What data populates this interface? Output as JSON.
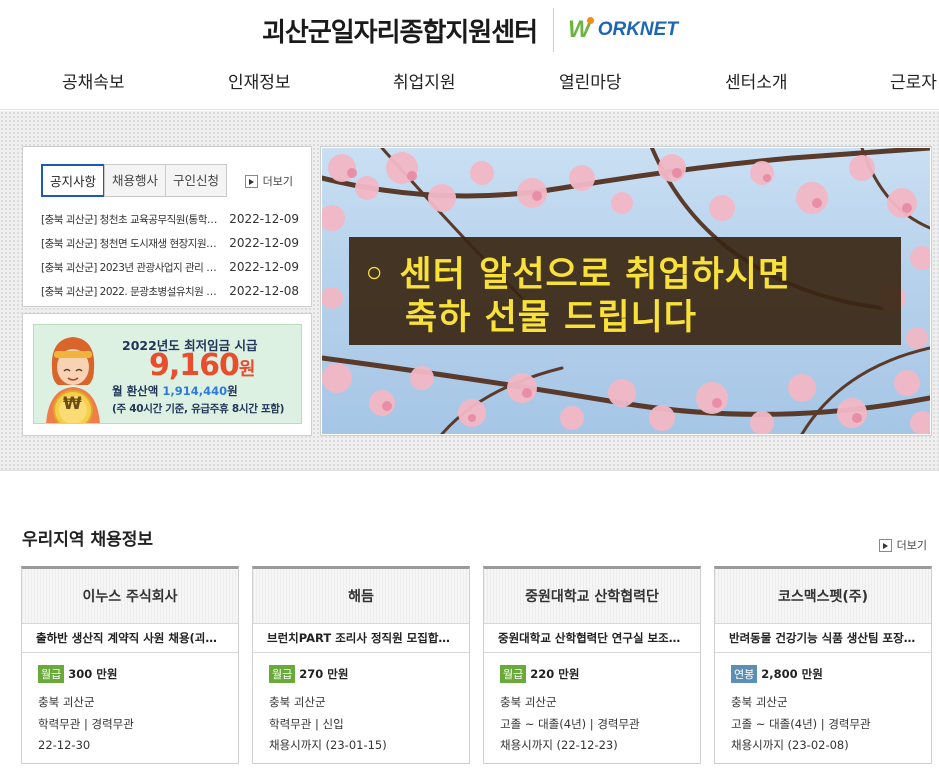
{
  "header": {
    "site_title": "괴산군일자리종합지원센터",
    "worknet_logo": {
      "first": "W",
      "rest": "ORKNET"
    },
    "nav": [
      "공채속보",
      "인재정보",
      "취업지원",
      "열린마당",
      "센터소개",
      "근로자"
    ]
  },
  "notice": {
    "tabs": [
      "공지사항",
      "채용행사",
      "구인신청"
    ],
    "active_tab": "공지사항",
    "more_label": "더보기",
    "items": [
      {
        "title": "[충북 괴산군] 청천초 교육공무직원(통학…",
        "date": "2022-12-09"
      },
      {
        "title": "[충북 괴산군] 청천면 도시재생 현장지원…",
        "date": "2022-12-09"
      },
      {
        "title": "[충북 괴산군] 2023년 관광사업지 관리 사…",
        "date": "2022-12-09"
      },
      {
        "title": "[충북 괴산군] 2022. 문광초병설유치원 거…",
        "date": "2022-12-08"
      }
    ]
  },
  "wage_banner": {
    "line1": "2022년도 최저임금 시급",
    "amount": "9,160",
    "unit": "원",
    "line3_prefix": "월 환산액 ",
    "line3_amount": "1,914,440",
    "line3_suffix": "원",
    "line4": "(주 40시간 기준, 유급주휴 8시간 포함)",
    "coin_symbol": "₩"
  },
  "main_banner": {
    "line1": "◦ 센터 알선으로 취업하시면",
    "line2": "축하 선물 드립니다"
  },
  "jobs": {
    "title": "우리지역 채용정보",
    "more_label": "더보기",
    "colors": {
      "monthly_badge": "#6aaa3a",
      "annual_badge": "#5b8fb5"
    },
    "cards": [
      {
        "company": "이누스 주식회사",
        "post": "출하반 생산직 계약직 사원 채용(괴산…",
        "pay_type": "월급",
        "pay": "300 만원",
        "location": "충북 괴산군",
        "requirements": "학력무관 | 경력무관",
        "deadline": "22-12-30"
      },
      {
        "company": "해듬",
        "post": "브런치PART 조리사 정직원 모집합…",
        "pay_type": "월급",
        "pay": "270 만원",
        "location": "충북 괴산군",
        "requirements": "학력무관 | 신입",
        "deadline": "채용시까지 (23-01-15)"
      },
      {
        "company": "중원대학교 산학협력단",
        "post": "중원대학교 산학협력단 연구실 보조…",
        "pay_type": "월급",
        "pay": "220 만원",
        "location": "충북 괴산군",
        "requirements": "고졸 ~ 대졸(4년) | 경력무관",
        "deadline": "채용시까지 (22-12-23)"
      },
      {
        "company": "코스맥스펫(주)",
        "post": "반려동물 건강기능 식품 생산팀 포장 …",
        "pay_type": "연봉",
        "pay": "2,800 만원",
        "location": "충북 괴산군",
        "requirements": "고졸 ~ 대졸(4년) | 경력무관",
        "deadline": "채용시까지 (23-02-08)"
      }
    ]
  }
}
